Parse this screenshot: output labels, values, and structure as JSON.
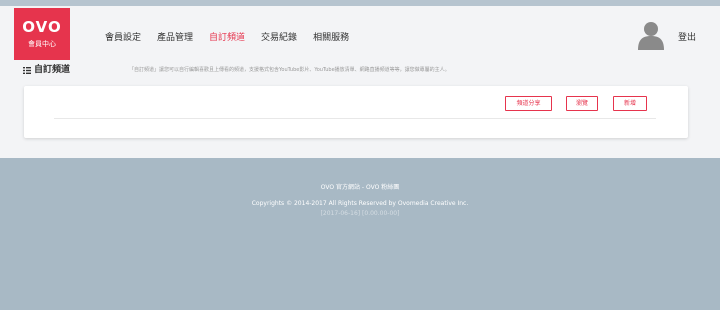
{
  "header": {
    "logo_text": "OVO",
    "logo_subtitle": "會員中心",
    "nav": [
      {
        "label": "會員設定",
        "active": false
      },
      {
        "label": "產品管理",
        "active": false
      },
      {
        "label": "自訂頻道",
        "active": true
      },
      {
        "label": "交易紀錄",
        "active": false
      },
      {
        "label": "相關服務",
        "active": false
      }
    ],
    "avatar_icon": "user-avatar-icon",
    "logout_label": "登出"
  },
  "page": {
    "title_icon": "list-icon",
    "title": "自訂頻道",
    "description": "「自訂頻道」讓您可以自行編輯喜歡且上傳看的頻道，支援格式包含YouTube影片、YouTube播放清單、網路直播頻道等等，讓您做專屬的主人。"
  },
  "panel": {
    "buttons": {
      "share": "頻道分享",
      "browse": "瀏覽",
      "add": "新增"
    }
  },
  "footer": {
    "links": "OVO 官方網站 - OVO 粉絲團",
    "copyright": "Copyrights © 2014-2017 All Rights Reserved by Ovomedia Creative Inc.",
    "version": "[2017-06-16] [0.00.00-00]"
  },
  "colors": {
    "brand": "#e6344d",
    "footer_bg": "#a8b9c5",
    "page_bg": "#f3f4f6"
  }
}
